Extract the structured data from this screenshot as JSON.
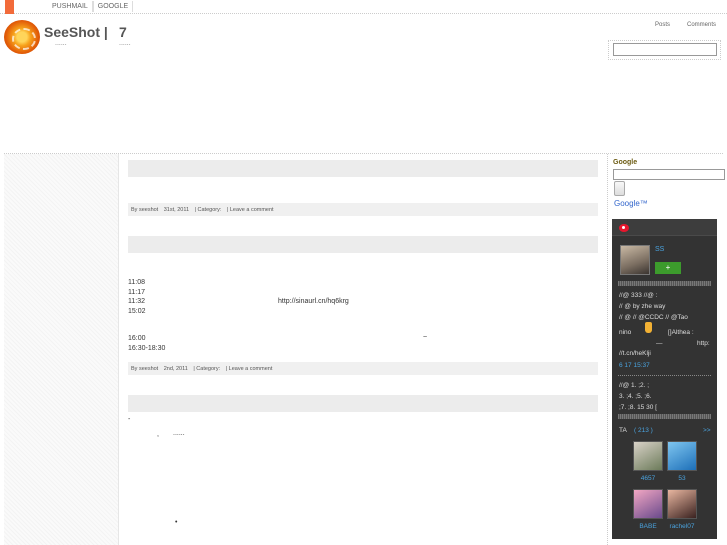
{
  "topnav": [
    "PUSHMAIL",
    "GOOGLE"
  ],
  "header": {
    "title": "SeeShot |",
    "count": "7",
    "dots_left": "......",
    "dots_right": "......"
  },
  "rss": {
    "posts": "Posts",
    "comments": "Comments"
  },
  "posts": [
    {
      "meta": {
        "by": "By seeshot",
        "date": "31st, 2011",
        "category": "| Category:",
        "comment": "| Leave a comment"
      }
    },
    {
      "lines": [
        {
          "text": "11:08"
        },
        {
          "text": "11:17"
        },
        {
          "text": "11:32"
        },
        {
          "text": "http://sinaurl.cn/hq6krg"
        },
        {
          "text": "15:02"
        },
        {
          "text": "16:00"
        },
        {
          "text": "~"
        },
        {
          "text": "16:30-18:30"
        }
      ],
      "meta": {
        "by": "By seeshot",
        "date": "2nd, 2011",
        "category": "| Category:",
        "comment": "| Leave a comment"
      }
    },
    {
      "lines": [
        {
          "text": "-"
        },
        {
          "text": ","
        },
        {
          "text": "......"
        },
        {
          "text": "•"
        }
      ]
    }
  ],
  "sidebar": {
    "google_heading": "Google",
    "google_logo": "Google™",
    "weibo": {
      "name": "SS",
      "follow": "+",
      "lines": [
        "//@  333          //@  :",
        "// @             by zhe way",
        "// @     // @CCDC     // @Tao",
        "nino",
        "[]Althea :",
        "—",
        "http:",
        "//t.cn/heKlji",
        "6 17  15:37",
        "//@          1.         ;2.          ;",
        "3.          ;4.   ;5.          ;6.",
        "   ;7.          ;8.  15    30   ["
      ],
      "ta_label": "TA",
      "ta_count": "( 213 )",
      "ta_more": ">>",
      "fans": [
        {
          "name": "4657",
          "color_a": "#d9d2c8",
          "color_b": "#6c7b5a"
        },
        {
          "name": "53",
          "color_a": "#7fc6f0",
          "color_b": "#1d6fb8"
        },
        {
          "name": "BABE",
          "color_a": "#f2a7c3",
          "color_b": "#6a4a8c"
        },
        {
          "name": "rachel07",
          "color_a": "#e8b6a0",
          "color_b": "#3a2220"
        }
      ]
    }
  }
}
